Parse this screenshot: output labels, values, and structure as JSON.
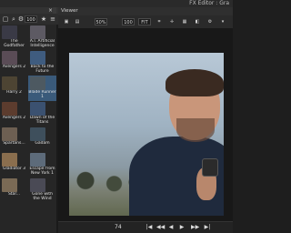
{
  "window": {
    "title": "FX Editor : Gra"
  },
  "browser": {
    "close_label": "×",
    "toolbar": {
      "count_value": "100",
      "star": "★",
      "menu": "≡"
    },
    "items": [
      {
        "label": "The Godfather",
        "thumb": "#3a3a46"
      },
      {
        "label": "A.I. Artificial Intelligence",
        "thumb": "#5d5a63"
      },
      {
        "label": "Avengers 2",
        "thumb": "#5a4c56"
      },
      {
        "label": "Back to the Future",
        "thumb": "#3f5c7f"
      },
      {
        "label": "Harry 2",
        "thumb": "#4d4433"
      },
      {
        "label": "Blade Runner 1",
        "thumb": "#4d5961"
      },
      {
        "label": "Avengers 2",
        "thumb": "#5c3c2e"
      },
      {
        "label": "Dawn of the Titans",
        "thumb": "#3b5170"
      },
      {
        "label": "Spartans...",
        "thumb": "#6d5f52"
      },
      {
        "label": "Gadam",
        "thumb": "#3e4f5c"
      },
      {
        "label": "Gladiator 3",
        "thumb": "#8a6e4e"
      },
      {
        "label": "Escape from New York 1",
        "thumb": "#5d6b7a"
      },
      {
        "label": "Star...",
        "thumb": "#7a6a55"
      },
      {
        "label": "Gone with the Wind",
        "thumb": "#4a4a55"
      }
    ]
  },
  "viewer": {
    "tab_label": "Viewer",
    "toolbar": {
      "zoom": "50%",
      "fit1": "100",
      "fit2": "FIT"
    }
  },
  "timeline": {
    "frame": "74",
    "buttons": [
      "|◀",
      "◀◀",
      "◀",
      "▶",
      "▶▶",
      "▶|"
    ]
  },
  "colors": {
    "selection": "#3a5a7a",
    "panel": "#262626"
  }
}
